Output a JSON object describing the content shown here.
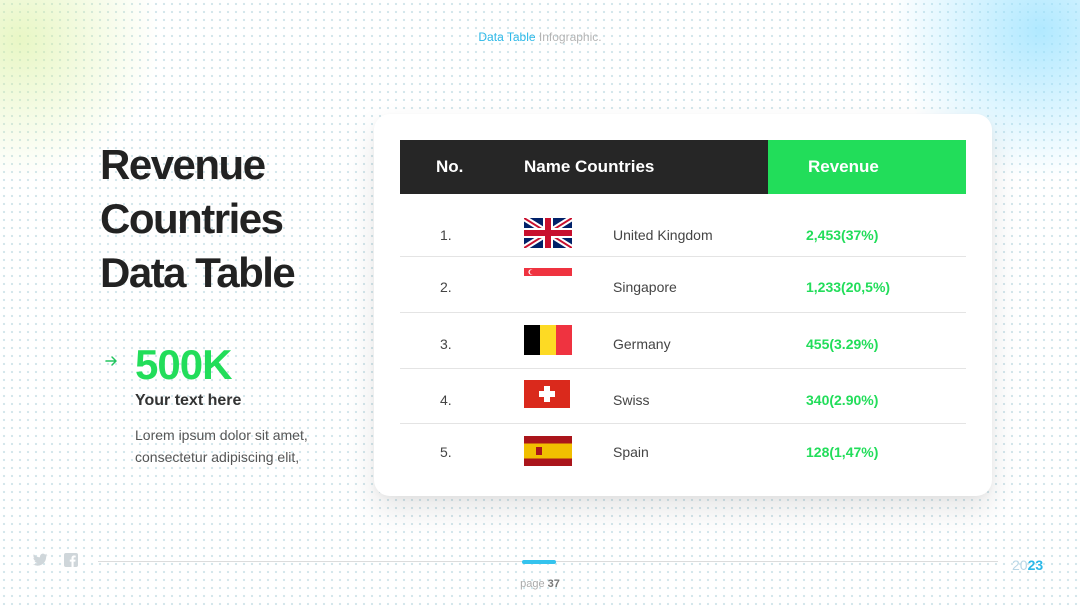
{
  "header": {
    "title_accent": "Data Table",
    "title_rest": " Infographic."
  },
  "title_lines": [
    "Revenue",
    "Countries",
    "Data Table"
  ],
  "stat": {
    "value": "500K",
    "label": "Your text here",
    "desc_line1": "Lorem ipsum dolor sit amet,",
    "desc_line2": "consectetur adipiscing elit,"
  },
  "table": {
    "headers": {
      "no": "No.",
      "name": "Name Countries",
      "revenue": "Revenue"
    },
    "rows": [
      {
        "no": "1.",
        "flag": "uk-flag",
        "country": "United Kingdom",
        "revenue": "2,453(37%)"
      },
      {
        "no": "2.",
        "flag": "singapore-flag",
        "country": "Singapore",
        "revenue": "1,233(20,5%)"
      },
      {
        "no": "3.",
        "flag": "belgium-flag",
        "country": "Germany",
        "revenue": "455(3.29%)"
      },
      {
        "no": "4.",
        "flag": "switzerland-flag",
        "country": "Swiss",
        "revenue": "340(2.90%)"
      },
      {
        "no": "5.",
        "flag": "spain-flag",
        "country": "Spain",
        "revenue": "128(1,47%)"
      }
    ]
  },
  "footer": {
    "page_label": "page ",
    "page_number": "37",
    "year_part1": "20",
    "year_part2": "23",
    "icons": [
      "twitter-icon",
      "facebook-icon"
    ]
  },
  "colors": {
    "accent_green": "#22dd5a",
    "accent_blue": "#2bb8e8",
    "header_dark": "#262626"
  }
}
